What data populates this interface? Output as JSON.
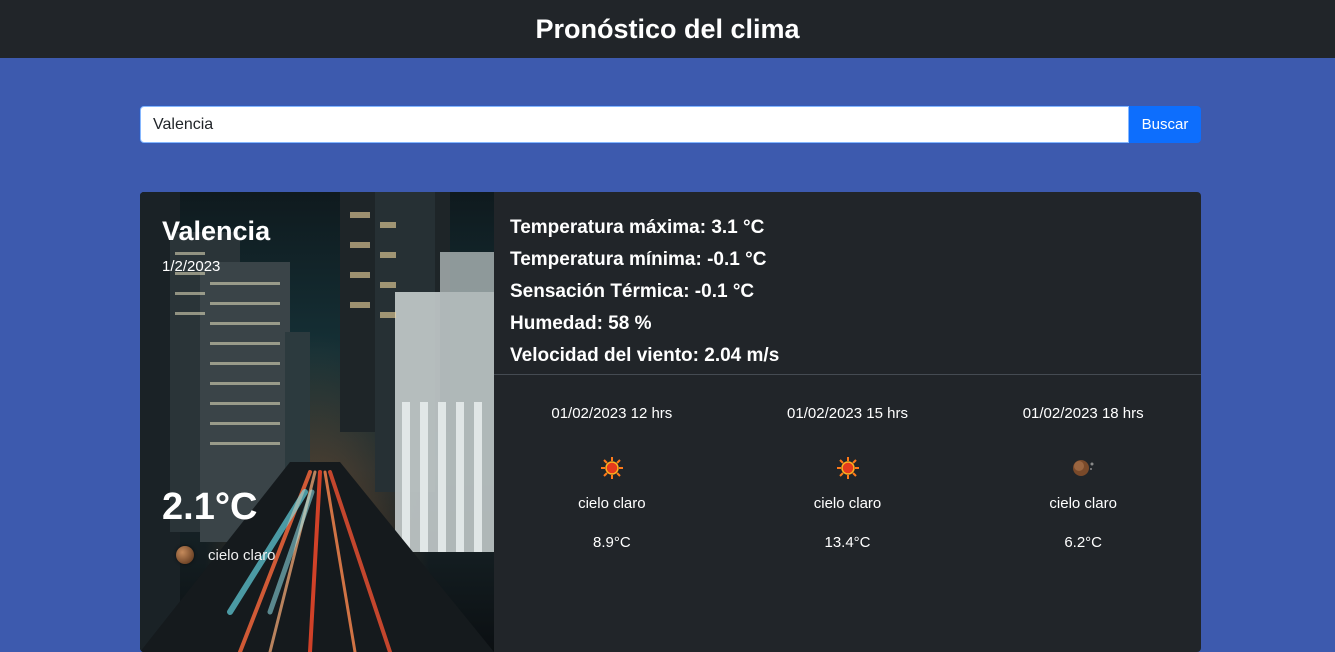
{
  "header": {
    "title": "Pronóstico del clima"
  },
  "search": {
    "value": "Valencia",
    "button_label": "Buscar"
  },
  "current": {
    "city": "Valencia",
    "date": "1/2/2023",
    "temperature": "2.1°C",
    "description": "cielo claro",
    "icon": "night-clear-icon"
  },
  "stats": {
    "max": "Temperatura máxima: 3.1 °C",
    "min": "Temperatura mínima: -0.1 °C",
    "feels": "Sensación Térmica: -0.1 °C",
    "humidity": "Humedad: 58 %",
    "wind": "Velocidad del viento: 2.04 m/s"
  },
  "forecast": [
    {
      "time": "01/02/2023 12 hrs",
      "icon": "sun-icon",
      "description": "cielo claro",
      "temp": "8.9°C"
    },
    {
      "time": "01/02/2023 15 hrs",
      "icon": "sun-icon",
      "description": "cielo claro",
      "temp": "13.4°C"
    },
    {
      "time": "01/02/2023 18 hrs",
      "icon": "moon-icon",
      "description": "cielo claro",
      "temp": "6.2°C"
    }
  ],
  "colors": {
    "page_bg": "#3d5aae",
    "navbar_bg": "#212529",
    "card_bg": "#212529",
    "button_bg": "#0d6efd"
  }
}
